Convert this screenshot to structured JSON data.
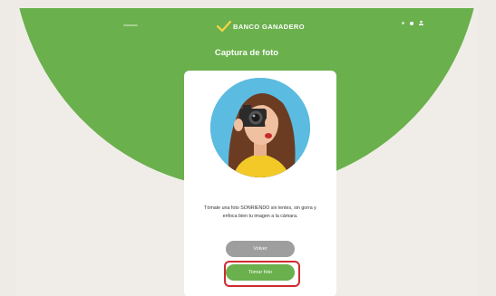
{
  "header": {
    "brand": "BANCO GANADERO",
    "icons": [
      "menu-icon",
      "logo-icon",
      "notifications-icon",
      "settings-icon",
      "user-icon"
    ]
  },
  "page": {
    "title": "Captura de foto"
  },
  "card": {
    "image": "woman-with-camera-photo",
    "instructions": "Tómate una foto SONRIENDO sin lentes, sin gorra y enfoca bien tu imagen a la cámara.",
    "back_label": "Volver",
    "take_photo_label": "Tomar foto"
  },
  "colors": {
    "brand_green": "#6ab04c",
    "background": "#f0ede8",
    "secondary_button": "#9e9e9e",
    "highlight": "#cf2b31"
  }
}
